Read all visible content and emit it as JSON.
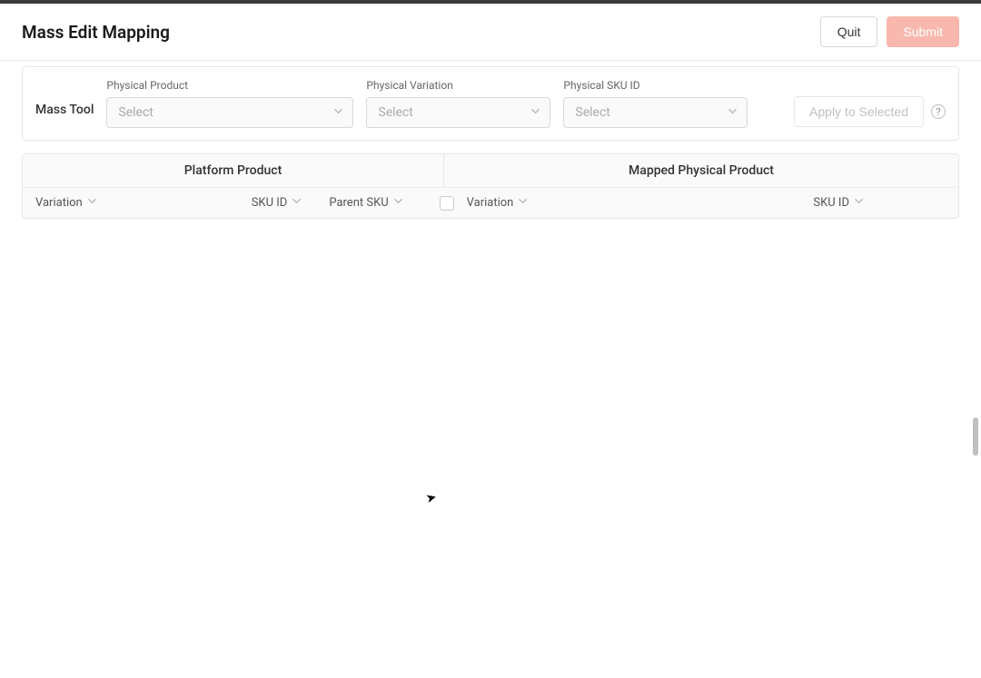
{
  "header": {
    "title": "Mass Edit Mapping",
    "quit_label": "Quit",
    "submit_label": "Submit"
  },
  "massTool": {
    "label": "Mass Tool",
    "physicalProduct": {
      "label": "Physical Product",
      "placeholder": "Select"
    },
    "physicalVariation": {
      "label": "Physical Variation",
      "placeholder": "Select"
    },
    "physicalSKU": {
      "label": "Physical SKU ID",
      "placeholder": "Select"
    },
    "apply_label": "Apply to Selected"
  },
  "table": {
    "groups": {
      "platform": "Platform Product",
      "mapped": "Mapped Physical Product"
    },
    "cols": {
      "variation_l": "Variation",
      "sku_l": "SKU ID",
      "parent_sku": "Parent SKU",
      "variation_r": "Variation",
      "sku_r": "SKU ID"
    }
  }
}
